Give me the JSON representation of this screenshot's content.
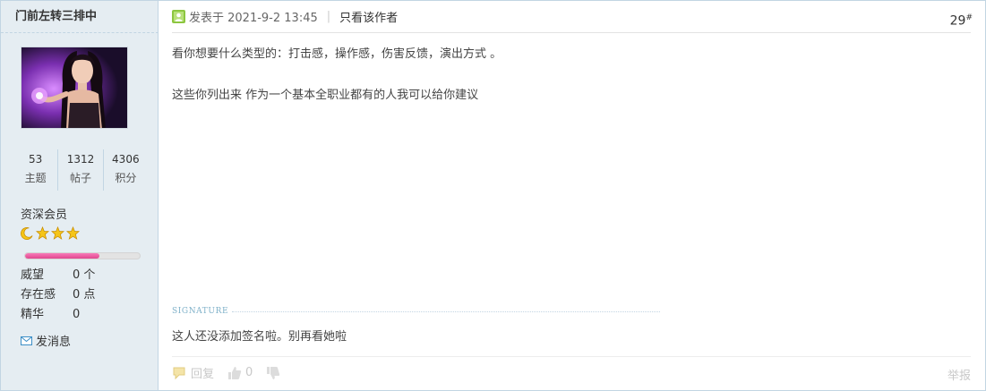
{
  "user": {
    "username": "门前左转三排中",
    "stats": [
      {
        "value": "53",
        "label": "主题"
      },
      {
        "value": "1312",
        "label": "帖子"
      },
      {
        "value": "4306",
        "label": "积分"
      }
    ],
    "group": "资深会员",
    "level_progress_percent": 65,
    "info": [
      {
        "key": "威望",
        "value": "0 个"
      },
      {
        "key": "存在感",
        "value": "0 点"
      },
      {
        "key": "精华",
        "value": "0"
      }
    ],
    "send_message": "发消息"
  },
  "post": {
    "posted_at": "发表于 2021-9-2 13:45",
    "separator": "|",
    "author_only": "只看该作者",
    "floor_number": "29",
    "floor_mark": "#",
    "paragraphs": [
      "看你想要什么类型的：打击感，操作感，伤害反馈，演出方式 。",
      "这些你列出来  作为一个基本全职业都有的人我可以给你建议"
    ],
    "signature_label": "SIGNATURE",
    "signature_text": "这人还没添加签名啦。别再看她啦",
    "footer": {
      "reply": "回复",
      "like_count": "0",
      "report": "举报"
    }
  },
  "colors": {
    "sidebar_bg": "#e5edf2",
    "border": "#c2d5e3",
    "progress_fill": "#e0478f",
    "star": "#f5c518",
    "online_green": "#8cc63f"
  }
}
